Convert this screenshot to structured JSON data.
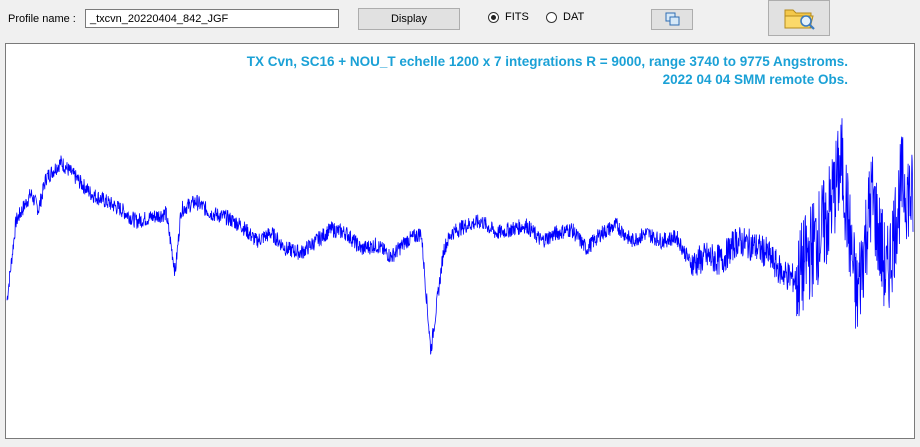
{
  "toolbar": {
    "profile_label": "Profile name :",
    "profile_value": "_txcvn_20220404_842_JGF",
    "display_label": "Display",
    "format_options": [
      {
        "label": "FITS",
        "selected": true
      },
      {
        "label": "DAT",
        "selected": false
      }
    ],
    "copy_icon": "copy-windows-icon",
    "open_icon": "folder-search-icon"
  },
  "plot": {
    "title_line1": "TX Cvn, SC16 + NOU_T echelle 1200 x 7 integrations R = 9000, range 3740 to 9775 Angstroms.",
    "title_line2": "2022 04 04 SMM remote Obs.",
    "title_color": "#1ba1d6",
    "line_color": "#0000ff"
  },
  "chart_data": {
    "type": "line",
    "x_range": [
      3740,
      9775
    ],
    "grid": false,
    "axes_visible": false,
    "series": [
      {
        "x": [
          3740,
          3800,
          3900,
          3950,
          4000,
          4100,
          4200,
          4300,
          4400,
          4500,
          4600,
          4700,
          4800,
          4861,
          4900,
          5000,
          5100,
          5200,
          5300,
          5400,
          5500,
          5600,
          5700,
          5800,
          5900,
          6000,
          6100,
          6200,
          6300,
          6400,
          6500,
          6563,
          6650,
          6700,
          6800,
          6900,
          7000,
          7100,
          7200,
          7300,
          7400,
          7500,
          7600,
          7700,
          7800,
          7900,
          8000,
          8100,
          8200,
          8300,
          8400,
          8500,
          8600,
          8700,
          8800,
          8900,
          9000,
          9100,
          9200,
          9300,
          9400,
          9500,
          9600,
          9700,
          9775
        ],
        "y": [
          0.35,
          0.55,
          0.62,
          0.58,
          0.66,
          0.7,
          0.66,
          0.62,
          0.6,
          0.58,
          0.55,
          0.56,
          0.57,
          0.42,
          0.58,
          0.6,
          0.57,
          0.56,
          0.54,
          0.5,
          0.52,
          0.48,
          0.47,
          0.5,
          0.53,
          0.52,
          0.48,
          0.49,
          0.46,
          0.5,
          0.52,
          0.22,
          0.48,
          0.52,
          0.54,
          0.55,
          0.52,
          0.53,
          0.54,
          0.5,
          0.52,
          0.53,
          0.48,
          0.52,
          0.54,
          0.5,
          0.52,
          0.5,
          0.51,
          0.44,
          0.46,
          0.45,
          0.5,
          0.49,
          0.47,
          0.42,
          0.4,
          0.48,
          0.55,
          0.7,
          0.35,
          0.62,
          0.4,
          0.65,
          0.6
        ]
      }
    ]
  }
}
